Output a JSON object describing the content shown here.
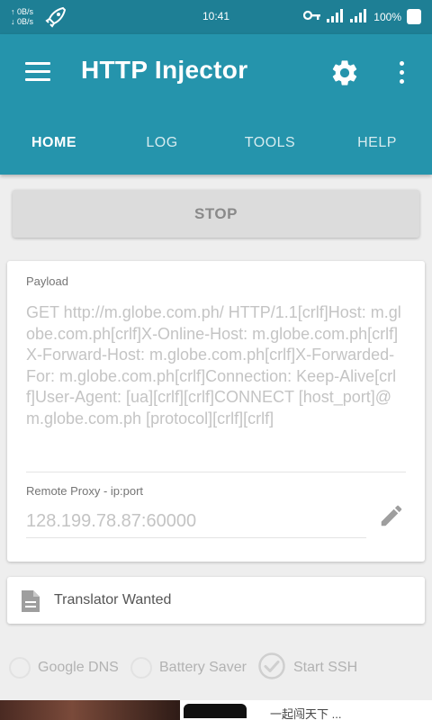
{
  "status_bar": {
    "up_speed": "↑ 0B/s",
    "down_speed": "↓ 0B/s",
    "time": "10:41",
    "battery": "100%"
  },
  "app_bar": {
    "title": "HTTP Injector",
    "color": "#2594ac",
    "status_bar_color": "#1e7f95"
  },
  "tabs": [
    {
      "label": "HOME",
      "active": true
    },
    {
      "label": "LOG",
      "active": false
    },
    {
      "label": "TOOLS",
      "active": false
    },
    {
      "label": "HELP",
      "active": false
    }
  ],
  "stop_button": {
    "label": "STOP"
  },
  "payload": {
    "label": "Payload",
    "value": "GET http://m.globe.com.ph/ HTTP/1.1[crlf]Host: m.globe.com.ph[crlf]X-Online-Host: m.globe.com.ph[crlf]X-Forward-Host: m.globe.com.ph[crlf]X-Forwarded-For: m.globe.com.ph[crlf]Connection: Keep-Alive[crlf]User-Agent: [ua][crlf][crlf]CONNECT [host_port]@m.globe.com.ph [protocol][crlf][crlf]"
  },
  "remote_proxy": {
    "label": "Remote Proxy - ip:port",
    "value": "128.199.78.87:60000"
  },
  "translator": {
    "label": "Translator Wanted"
  },
  "options": [
    {
      "label": "Google DNS",
      "checked": false
    },
    {
      "label": "Battery Saver",
      "checked": false
    },
    {
      "label": "Start SSH",
      "checked": true
    }
  ],
  "ad_banner": {
    "text": "一起闯天下 ..."
  }
}
